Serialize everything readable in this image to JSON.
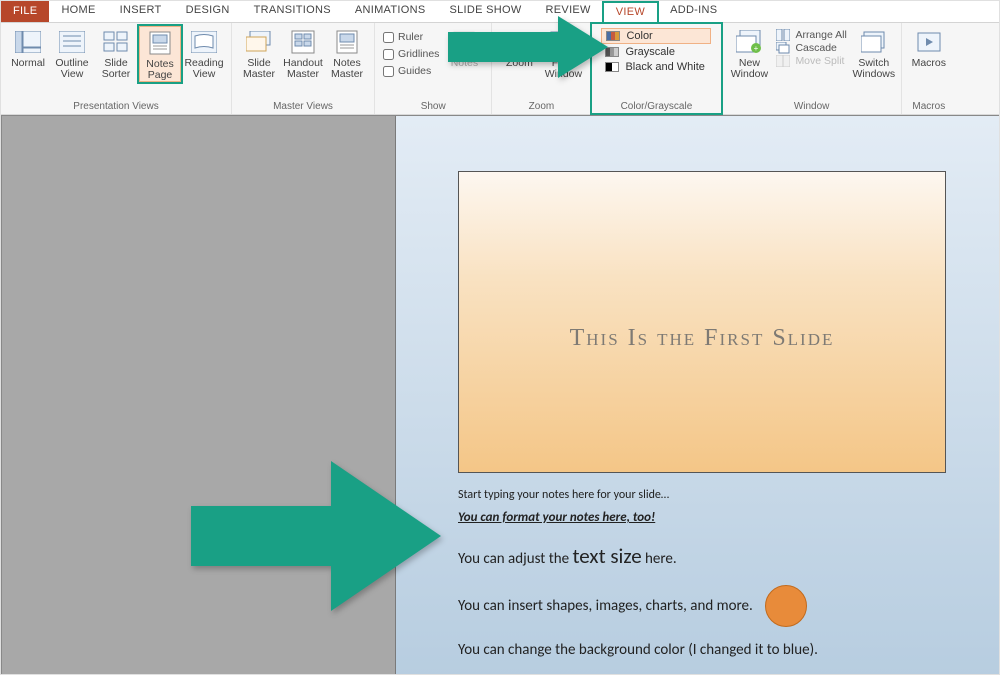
{
  "tabs": {
    "file": "FILE",
    "home": "HOME",
    "insert": "INSERT",
    "design": "DESIGN",
    "transitions": "TRANSITIONS",
    "animations": "ANIMATIONS",
    "slideshow": "SLIDE SHOW",
    "review": "REVIEW",
    "view": "VIEW",
    "addins": "ADD-INS"
  },
  "ribbon": {
    "presentation_views": {
      "label": "Presentation Views",
      "normal": "Normal",
      "outline": "Outline\nView",
      "sorter": "Slide\nSorter",
      "notes": "Notes\nPage",
      "reading": "Reading\nView"
    },
    "master_views": {
      "label": "Master Views",
      "slide": "Slide\nMaster",
      "handout": "Handout\nMaster",
      "notesm": "Notes\nMaster"
    },
    "show": {
      "label": "Show",
      "ruler": "Ruler",
      "gridlines": "Gridlines",
      "guides": "Guides",
      "notes": "Notes"
    },
    "zoom": {
      "label": "Zoom",
      "zoom": "Zoom",
      "fit": "Fit to\nWindow"
    },
    "color": {
      "label": "Color/Grayscale",
      "color": "Color",
      "grayscale": "Grayscale",
      "bw": "Black and White"
    },
    "window": {
      "label": "Window",
      "new": "New\nWindow",
      "arrange": "Arrange All",
      "cascade": "Cascade",
      "move": "Move Split",
      "switch": "Switch\nWindows"
    },
    "macros": {
      "label": "Macros",
      "macros": "Macros"
    }
  },
  "slide": {
    "title": "This Is the First Slide"
  },
  "notes": {
    "l1": "Start typing your notes here for your slide…",
    "l2": "You can format your notes here, too!",
    "l3a": "You can adjust the ",
    "l3b": "text size",
    "l3c": " here.",
    "l4": "You can insert shapes, images, charts, and more.",
    "l5": "You can change the background color (I changed it to blue)."
  }
}
